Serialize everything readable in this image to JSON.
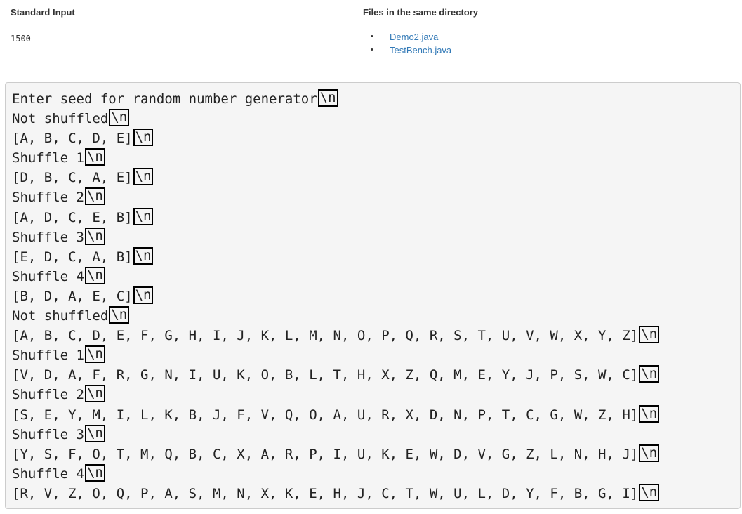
{
  "header": {
    "standard_input": "Standard Input",
    "files_dir": "Files in the same directory"
  },
  "stdin": {
    "value": "1500"
  },
  "files": [
    "Demo2.java",
    "TestBench.java"
  ],
  "newline_marker": "\\n",
  "output": [
    "Enter seed for random number generator",
    "Not shuffled",
    "[A, B, C, D, E]",
    "Shuffle 1",
    "[D, B, C, A, E]",
    "Shuffle 2",
    "[A, D, C, E, B]",
    "Shuffle 3",
    "[E, D, C, A, B]",
    "Shuffle 4",
    "[B, D, A, E, C]",
    "Not shuffled",
    "[A, B, C, D, E, F, G, H, I, J, K, L, M, N, O, P, Q, R, S, T, U, V, W, X, Y, Z]",
    "Shuffle 1",
    "[V, D, A, F, R, G, N, I, U, K, O, B, L, T, H, X, Z, Q, M, E, Y, J, P, S, W, C]",
    "Shuffle 2",
    "[S, E, Y, M, I, L, K, B, J, F, V, Q, O, A, U, R, X, D, N, P, T, C, G, W, Z, H]",
    "Shuffle 3",
    "[Y, S, F, O, T, M, Q, B, C, X, A, R, P, I, U, K, E, W, D, V, G, Z, L, N, H, J]",
    "Shuffle 4",
    "[R, V, Z, O, Q, P, A, S, M, N, X, K, E, H, J, C, T, W, U, L, D, Y, F, B, G, I]"
  ]
}
